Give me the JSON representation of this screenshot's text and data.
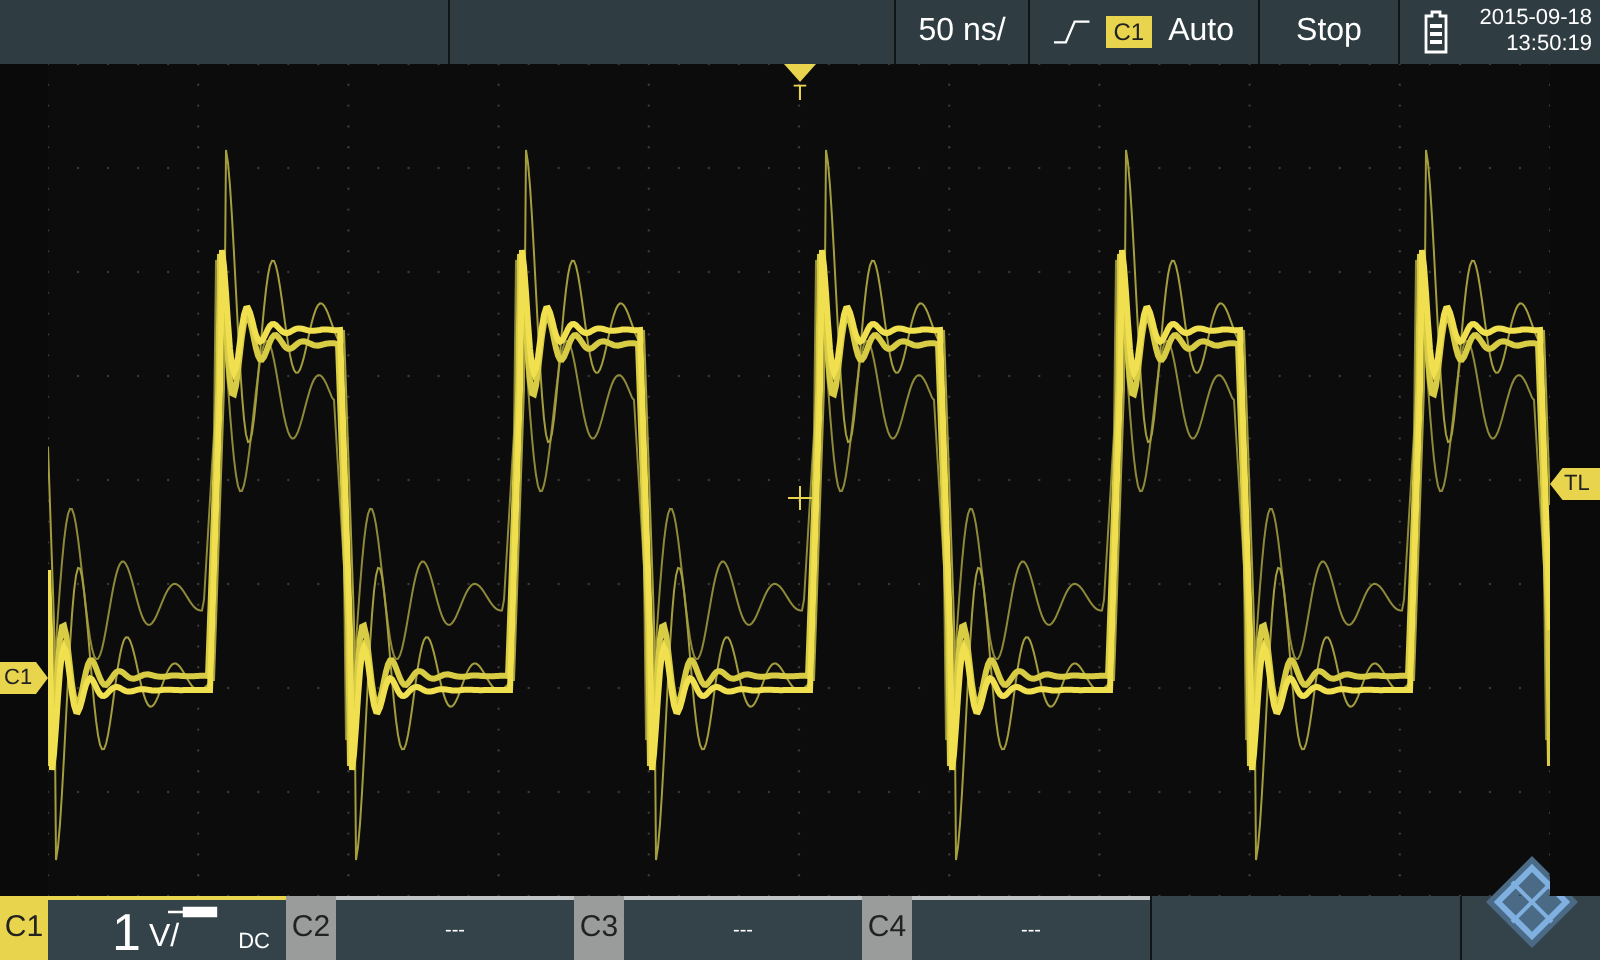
{
  "top_bar": {
    "timebase": "50 ns/",
    "trigger": {
      "source": "C1",
      "mode": "Auto"
    },
    "run_state": "Stop",
    "date": "2015-09-18",
    "time": "13:50:19"
  },
  "markers": {
    "trigger_position": "T",
    "trigger_level": "TL",
    "channel": "C1"
  },
  "channels": [
    {
      "label": "C1",
      "active": true,
      "scale": "1",
      "unit": "V/",
      "coupling": "DC"
    },
    {
      "label": "C2",
      "active": false,
      "scale": "---"
    },
    {
      "label": "C3",
      "active": false,
      "scale": "---"
    },
    {
      "label": "C4",
      "active": false,
      "scale": "---"
    }
  ]
}
